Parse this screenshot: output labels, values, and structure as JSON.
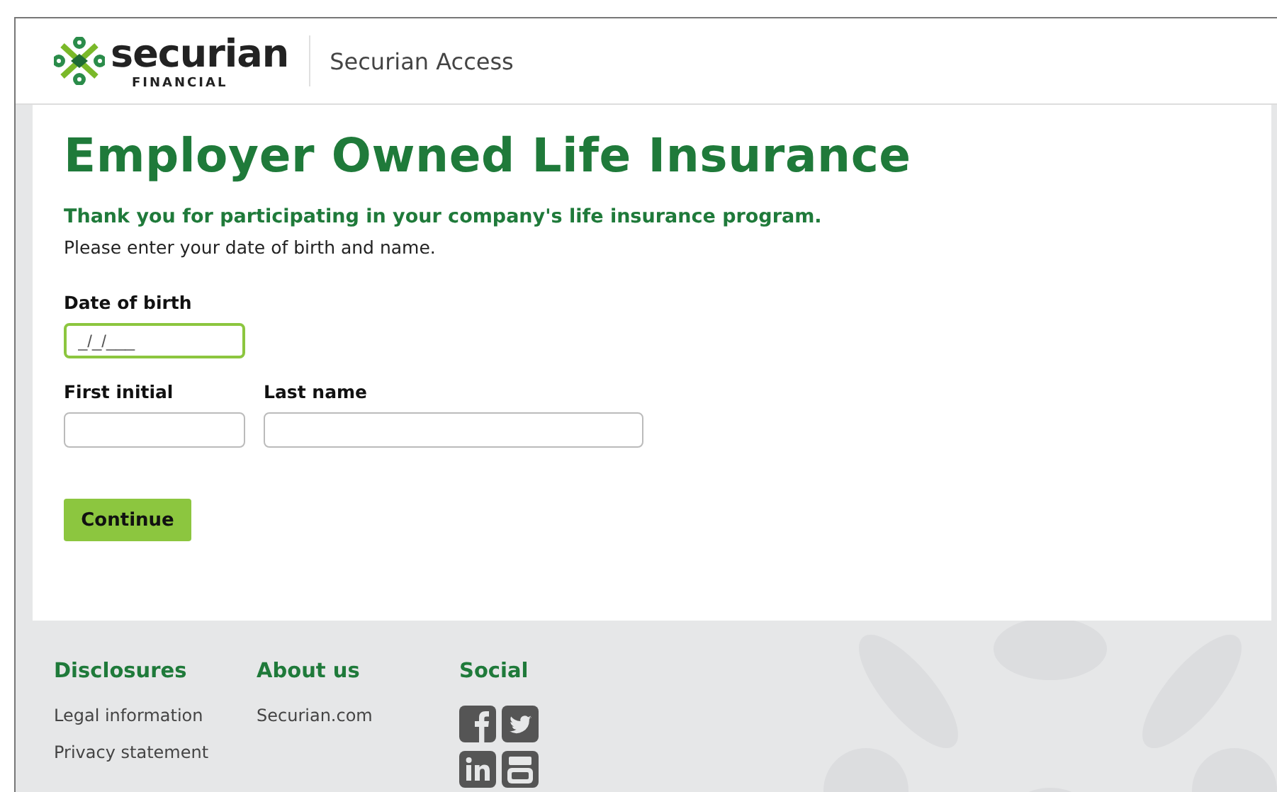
{
  "header": {
    "logo": {
      "name": "securian",
      "tagline": "FINANCIAL"
    },
    "app_title": "Securian Access"
  },
  "form": {
    "title": "Employer Owned Life Insurance",
    "subtitle": "Thank you for participating in your company's life insurance program.",
    "instructions": "Please enter your date of birth and name.",
    "fields": [
      {
        "label": "Date of birth",
        "placeholder": "_/_/___",
        "focused": true
      },
      {
        "label": "First initial",
        "focused": false
      },
      {
        "label": "Last name",
        "focused": false
      }
    ],
    "button": "Continue"
  },
  "footer": {
    "columns": [
      {
        "kind": "links",
        "heading": "Disclosures",
        "links": [
          "Legal information",
          "Privacy statement"
        ]
      },
      {
        "kind": "links",
        "heading": "About us",
        "links": [
          "Securian.com"
        ]
      },
      {
        "kind": "social",
        "heading": "Social"
      }
    ]
  }
}
